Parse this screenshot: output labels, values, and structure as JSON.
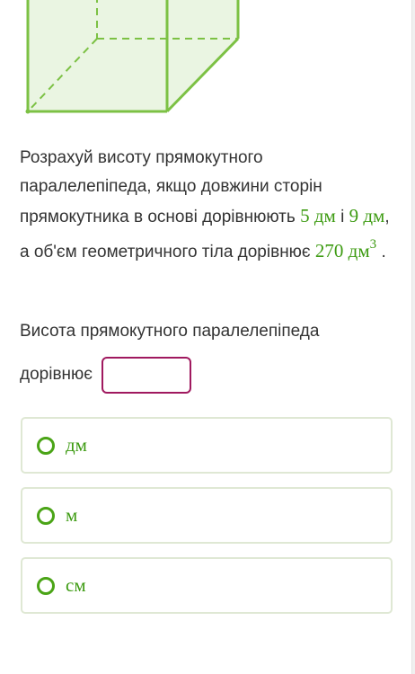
{
  "problem": {
    "text_before": "Розрахуй висоту прямокутного паралелепіпеда, якщо довжини сторін прямокутника в основі дорівнюють ",
    "side_a": "5 дм",
    "between": " і ",
    "side_b": "9 дм",
    "text_mid": ", а об'єм геометричного тіла дорівнює ",
    "volume": "270 дм",
    "volume_exp": "3",
    "text_end": "."
  },
  "question": {
    "line1": "Висота прямокутного паралелепіпеда",
    "line2": "дорівнює",
    "answer_value": ""
  },
  "options": [
    {
      "label": "дм"
    },
    {
      "label": "м"
    },
    {
      "label": "см"
    }
  ],
  "colors": {
    "accent_green": "#3d9b12",
    "answer_border": "#a0195f",
    "figure_fill": "#eaf5e2",
    "figure_line": "#7cc144"
  }
}
